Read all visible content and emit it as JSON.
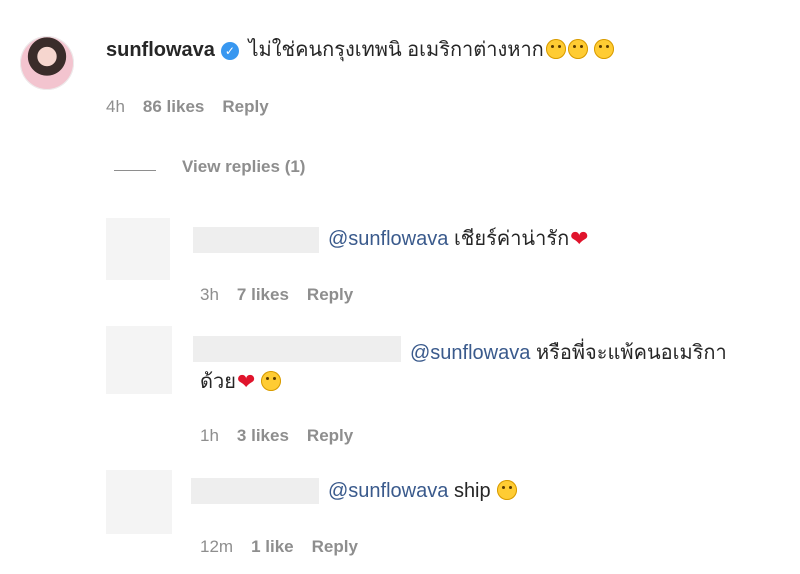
{
  "main_comment": {
    "username": "sunflowava",
    "text": "ไม่ใช่คนกรุงเทพนิ อเมริกาต่างหาก",
    "emojis": [
      "rofl-face",
      "smirk-face",
      "grin-face"
    ],
    "time": "4h",
    "likes": "86 likes",
    "reply_label": "Reply"
  },
  "view_replies": "View replies (1)",
  "replies": [
    {
      "mention": "@sunflowava",
      "text": "เชียร์ค่าน่ารัก",
      "time": "3h",
      "likes": "7 likes",
      "reply_label": "Reply"
    },
    {
      "mention": "@sunflowava",
      "text": "หรือพี่จะแพ้คนอเมริกา",
      "text_line2": "ด้วย",
      "time": "1h",
      "likes": "3 likes",
      "reply_label": "Reply"
    },
    {
      "mention": "@sunflowava",
      "text": "ship",
      "time": "12m",
      "likes": "1 like",
      "reply_label": "Reply"
    }
  ],
  "colors": {
    "mention": "#3a5a8c",
    "meta": "#8e8e8e",
    "verified": "#3897f0",
    "heart": "#e0142c"
  }
}
